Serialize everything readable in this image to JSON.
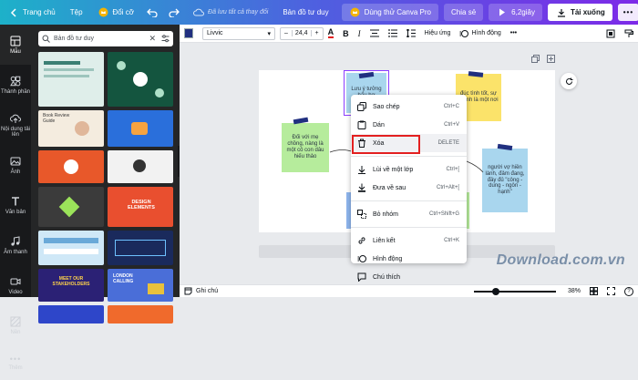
{
  "topbar": {
    "home": "Trang chủ",
    "file": "Tệp",
    "resize": "Đổi cỡ",
    "saved_status": "Đã lưu tất cả thay đổi",
    "doc_title": "Bản đồ tư duy",
    "try_pro": "Dùng thử Canva Pro",
    "share": "Chia sẻ",
    "timer": "6,2giây",
    "download": "Tải xuống"
  },
  "rail": [
    {
      "label": "Mẫu",
      "icon": "template-icon"
    },
    {
      "label": "Thành phần",
      "icon": "elements-icon"
    },
    {
      "label": "Nội dung tải lên",
      "icon": "upload-icon"
    },
    {
      "label": "Ảnh",
      "icon": "photo-icon"
    },
    {
      "label": "Văn bản",
      "icon": "text-icon"
    },
    {
      "label": "Âm thanh",
      "icon": "audio-icon"
    },
    {
      "label": "Video",
      "icon": "video-icon"
    },
    {
      "label": "Nền",
      "icon": "background-icon"
    },
    {
      "label": "Thêm",
      "icon": "more-icon"
    }
  ],
  "search": {
    "value": "Bản đồ tư duy"
  },
  "thumbs": [
    {
      "label": "",
      "color": "#dfeeea"
    },
    {
      "label": "",
      "color": "#14553f"
    },
    {
      "label": "Book Review Guide",
      "color": "#f4ecdf"
    },
    {
      "label": "",
      "color": "#2a6fdb"
    },
    {
      "label": "",
      "color": "#e8582a"
    },
    {
      "label": "",
      "color": "#f2f2f2"
    },
    {
      "label": "",
      "color": "#3b3b3b"
    },
    {
      "label": "DESIGN ELEMENTS",
      "color": "#e94f2f"
    },
    {
      "label": "",
      "color": "#cfe8f7"
    },
    {
      "label": "",
      "color": "#1a2a5c"
    },
    {
      "label": "MEET OUR STAKEHOLDERS",
      "color": "#2b2175"
    },
    {
      "label": "LONDON CALLING",
      "color": "#4a6ed8"
    },
    {
      "label": "",
      "color": "#2e46c9"
    },
    {
      "label": "",
      "color": "#f06a2c"
    }
  ],
  "ctxbar": {
    "font": "Livvic",
    "size": "24,4",
    "effects": "Hiệu ứng",
    "animate": "Hình động"
  },
  "notes": [
    {
      "text": "Lưu ý tưởng hấu hơ",
      "color": "#a9d6ee"
    },
    {
      "text": "đúc tình tốt, sự thành là một nơi",
      "color": "#fbe36a"
    },
    {
      "text": "Đối với mẹ chồng, nàng là một cô con dâu hiếu thảo",
      "color": "#b6ec9c"
    },
    {
      "text": "người vợ hiền lành, đảm đang, đầy đủ \"công - dung - ngôn - hạnh\"",
      "color": "#a9d6ee"
    }
  ],
  "menu": {
    "items": [
      {
        "label": "Sao chép",
        "shortcut": "Ctrl+C",
        "icon": "copy-icon"
      },
      {
        "label": "Dán",
        "shortcut": "Ctrl+V",
        "icon": "paste-icon"
      },
      {
        "label": "Xóa",
        "shortcut": "DELETE",
        "icon": "trash-icon"
      },
      {
        "label": "Lùi về một lớp",
        "shortcut": "Ctrl+[",
        "icon": "backward-icon"
      },
      {
        "label": "Đưa về sau",
        "shortcut": "Ctrl+Alt+[",
        "icon": "send-back-icon"
      },
      {
        "label": "Bỏ nhóm",
        "shortcut": "Ctrl+Shift+G",
        "icon": "ungroup-icon"
      },
      {
        "label": "Liên kết",
        "shortcut": "Ctrl+K",
        "icon": "link-icon"
      },
      {
        "label": "Hình động",
        "shortcut": "",
        "icon": "animate-icon"
      },
      {
        "label": "Chú thích",
        "shortcut": "",
        "icon": "comment-icon"
      }
    ]
  },
  "bottombar": {
    "notes": "Ghi chú",
    "zoom": "38%"
  },
  "watermark": "Download.com.vn"
}
